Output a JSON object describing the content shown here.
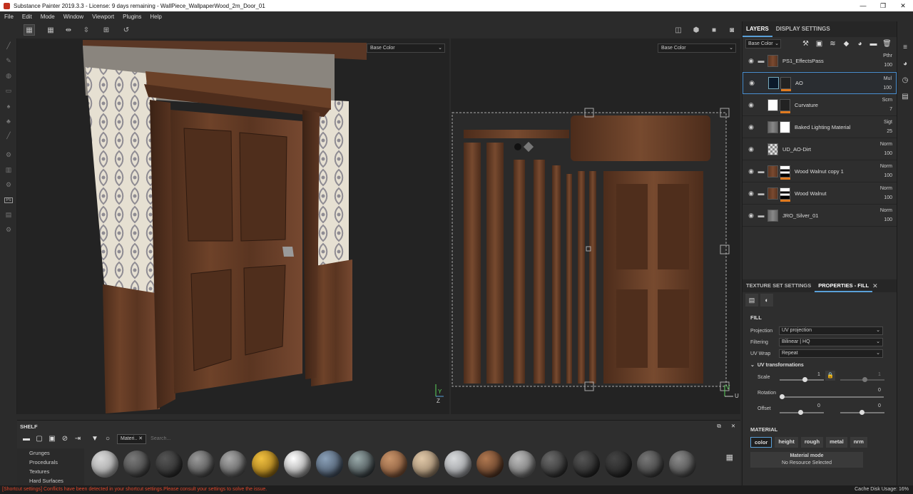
{
  "window": {
    "title": "Substance Painter 2019.3.3 - License: 9 days remaining - WallPiece_WallpaperWood_2m_Door_01",
    "controls": [
      "—",
      "❐",
      "✕"
    ]
  },
  "menu": [
    "File",
    "Edit",
    "Mode",
    "Window",
    "Viewport",
    "Plugins",
    "Help"
  ],
  "viewport3d": {
    "channel": "Base Color"
  },
  "viewport2d": {
    "channel": "Base Color",
    "axis_v": "V",
    "axis_u": "U"
  },
  "axes3d": {
    "y": "Y",
    "z": "Z"
  },
  "layers_panel": {
    "tabs": [
      "LAYERS",
      "DISPLAY SETTINGS"
    ],
    "channel": "Base Color",
    "layers": [
      {
        "name": "PS1_EffectsPass",
        "blend": "Pthr",
        "opacity": "100"
      },
      {
        "name": "AO",
        "blend": "Mul",
        "opacity": "100"
      },
      {
        "name": "Curvature",
        "blend": "Scrn",
        "opacity": "7"
      },
      {
        "name": "Baked Lighting Material",
        "blend": "Sigt",
        "opacity": "25"
      },
      {
        "name": "UD_AO-Dirt",
        "blend": "Norm",
        "opacity": "100"
      },
      {
        "name": "Wood Walnut copy 1",
        "blend": "Norm",
        "opacity": "100"
      },
      {
        "name": "Wood Walnut",
        "blend": "Norm",
        "opacity": "100"
      },
      {
        "name": "JRO_Silver_01",
        "blend": "Norm",
        "opacity": "100"
      }
    ]
  },
  "properties": {
    "tabs": [
      "TEXTURE SET SETTINGS",
      "PROPERTIES - FILL"
    ],
    "fill_title": "FILL",
    "projection": {
      "label": "Projection",
      "value": "UV projection"
    },
    "filtering": {
      "label": "Filtering",
      "value": "Bilinear | HQ"
    },
    "uvwrap": {
      "label": "UV Wrap",
      "value": "Repeat"
    },
    "uvtransform": "UV transformations",
    "scale": {
      "label": "Scale",
      "value": "1",
      "value2": "1"
    },
    "rotation": {
      "label": "Rotation",
      "value": "0"
    },
    "offset": {
      "label": "Offset",
      "value": "0",
      "value2": "0"
    },
    "material_title": "MATERIAL",
    "channels": [
      "color",
      "height",
      "rough",
      "metal",
      "nrm"
    ],
    "material_mode": "Material mode",
    "no_resource": "No Resource Selected"
  },
  "shelf": {
    "title": "SHELF",
    "filter": "Materi..",
    "search_placeholder": "Search...",
    "categories": [
      "Grunges",
      "Procedurals",
      "Textures",
      "Hard Surfaces"
    ]
  },
  "status": {
    "warning": "[Shortcut settings] Conflicts have been detected in your shortcut settings.Please consult your settings to solve the issue.",
    "cache": "Cache Disk Usage:   16%"
  }
}
